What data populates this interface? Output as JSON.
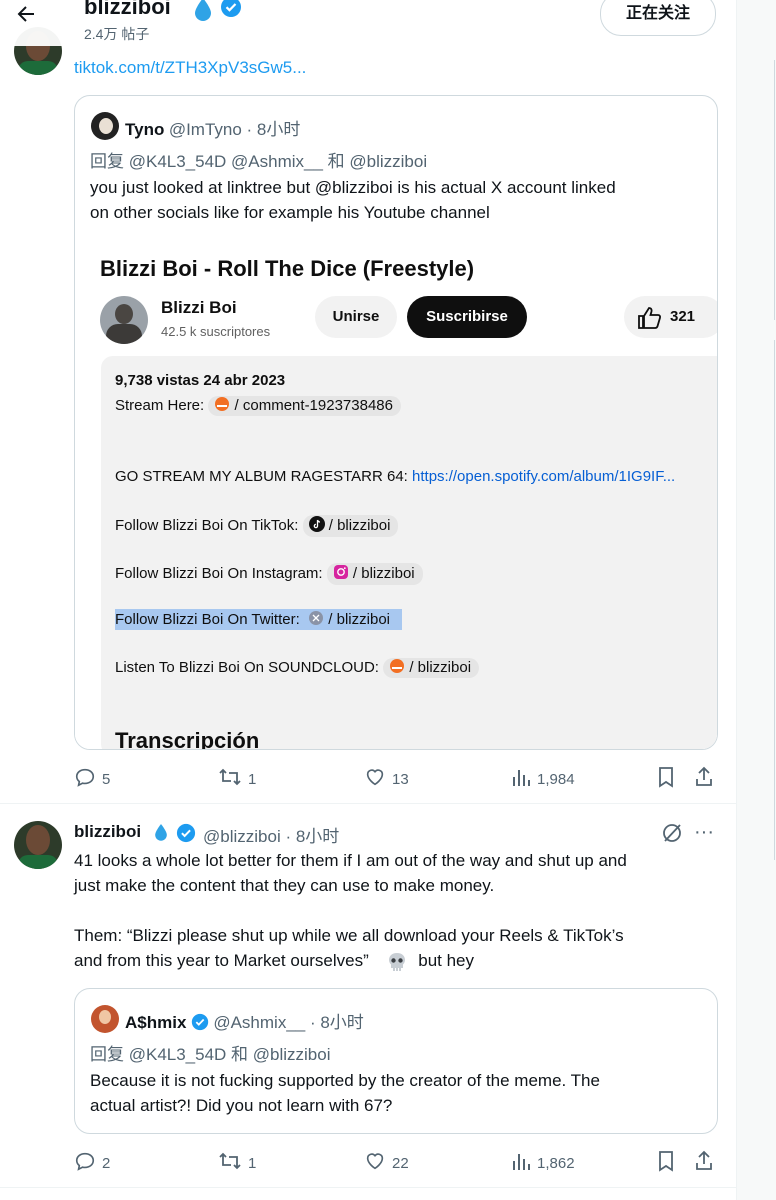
{
  "header": {
    "name": "blizziboi",
    "posts_count": "2.4万 帖子",
    "follow_label": "正在关注"
  },
  "post1": {
    "link": "tiktok.com/t/ZTH3XpV3sGw5...",
    "quote": {
      "name": "Tyno",
      "meta": "@ImTyno · 8小时",
      "reply_to": "回复 @K4L3_54D @Ashmix__ 和 @blizziboi",
      "text_line1": "you just looked at linktree but @blizziboi is his actual X account linked",
      "text_line2": "on other socials like for example his Youtube channel",
      "media": {
        "video_title": "Blizzi Boi - Roll The Dice (Freestyle)",
        "channel": "Blizzi Boi",
        "subscribers": "42.5 k suscriptores",
        "join_label": "Unirse",
        "subscribe_label": "Suscribirse",
        "likes": "321",
        "views_date": "9,738 vistas  24 abr 2023",
        "stream_prefix": "Stream Here:",
        "stream_chip": "/ comment-1923738486",
        "album_prefix": "GO STREAM MY ALBUM RAGESTARR 64:",
        "album_link": "https://open.spotify.com/album/1IG9IF...",
        "tiktok_prefix": "Follow Blizzi Boi On TikTok:",
        "tiktok_chip": "/ blizziboi",
        "instagram_prefix": "Follow Blizzi Boi On Instagram:",
        "instagram_chip": "/ blizziboi",
        "twitter_prefix": "Follow Blizzi Boi On Twitter:",
        "twitter_chip": "/ blizziboi",
        "soundcloud_prefix": "Listen To Blizzi Boi On SOUNDCLOUD:",
        "soundcloud_chip": "/ blizziboi",
        "transcript_heading": "Transcripción"
      }
    },
    "actions": {
      "replies": "5",
      "reposts": "1",
      "likes": "13",
      "views": "1,984"
    }
  },
  "post2": {
    "name": "blizziboi",
    "meta": "@blizziboi · 8小时",
    "text_line1": "41 looks a whole lot better for them if I am out of the way and shut up and",
    "text_line2": "just make the content that they can use to make money.",
    "text_line3": "Them: “Blizzi please shut up while we all download your Reels & TikTok’s",
    "text_line4a": "and  from this year to Market ourselves”",
    "text_line4b": "but hey",
    "quote": {
      "name": "A$hmix",
      "meta": "@Ashmix__ · 8小时",
      "reply_to": "回复 @K4L3_54D 和 @blizziboi",
      "text_line1": "Because it is not fucking supported by the creator of the meme. The",
      "text_line2": "actual artist?! Did you not learn with 67?"
    },
    "actions": {
      "replies": "2",
      "reposts": "1",
      "likes": "22",
      "views": "1,862"
    }
  },
  "colors": {
    "accent": "#1d9bf0",
    "text": "#0f1419",
    "muted": "#536471",
    "verified": "#1d9bf0"
  }
}
